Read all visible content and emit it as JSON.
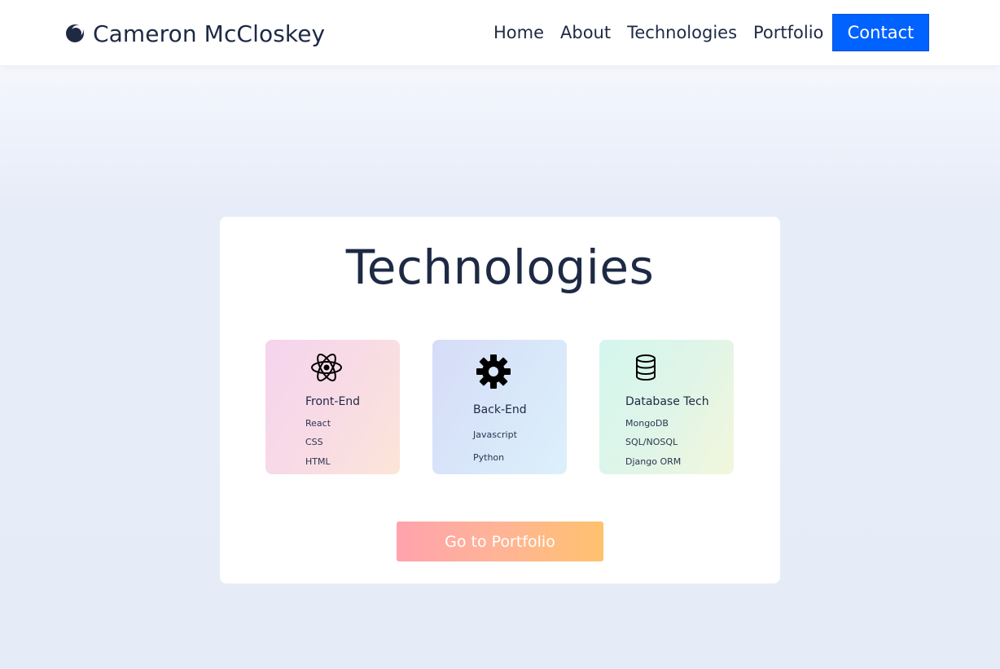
{
  "navbar": {
    "brand": {
      "name": "Cameron McCloskey",
      "icon": "moon-icon"
    },
    "links": [
      {
        "label": "Home"
      },
      {
        "label": "About"
      },
      {
        "label": "Technologies"
      },
      {
        "label": "Portfolio"
      }
    ],
    "contact_label": "Contact"
  },
  "section": {
    "title": "Technologies",
    "cards": [
      {
        "icon": "react-atom-icon",
        "title": "Front-End",
        "items": [
          "React",
          "CSS",
          "HTML"
        ]
      },
      {
        "icon": "gear-icon",
        "title": "Back-End",
        "items": [
          "Javascript",
          "Python"
        ]
      },
      {
        "icon": "database-icon",
        "title": "Database Tech",
        "items": [
          "MongoDB",
          "SQL/NOSQL",
          "Django ORM"
        ]
      }
    ],
    "button_label": "Go to Portfolio"
  },
  "colors": {
    "accent": "#0062ff",
    "text": "#1e2a44",
    "background": "#e6ecf8",
    "button_gradient_start": "#ffa3ad",
    "button_gradient_end": "#ffc26e"
  }
}
